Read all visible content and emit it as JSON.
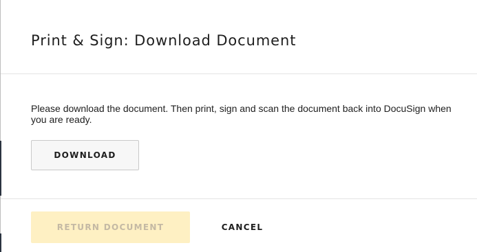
{
  "dialog": {
    "title": "Print & Sign: Download Document",
    "message": "Please download the document. Then print, sign and scan the document back into DocuSign when you are ready.",
    "download_label": "DOWNLOAD",
    "return_label": "RETURN DOCUMENT",
    "cancel_label": "CANCEL",
    "return_enabled": false
  },
  "colors": {
    "title_text": "#1e1e1e",
    "divider": "#e3e3e3",
    "download_bg": "#f7f7f7",
    "download_border": "#c9c9c9",
    "return_bg_disabled": "#fef0c3",
    "return_text_disabled": "#c4b9a4"
  }
}
